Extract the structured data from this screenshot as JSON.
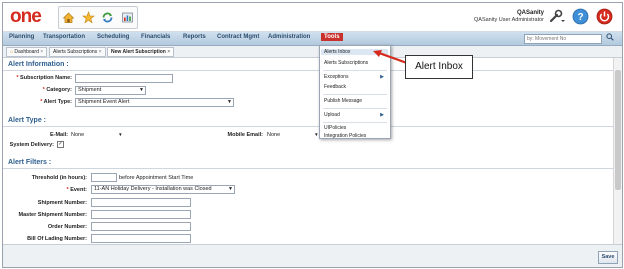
{
  "app": {
    "logo_text": "one"
  },
  "header": {
    "user_name": "QASanity",
    "user_role": "QASanity User Administrator",
    "quick_icons": [
      "home-icon",
      "star-icon",
      "refresh-icon",
      "report-icon"
    ],
    "right_icons": [
      "wrench-icon",
      "help-icon",
      "power-icon"
    ]
  },
  "nav": {
    "items": [
      "Planning",
      "Transportation",
      "Scheduling",
      "Financials",
      "Reports",
      "Contract Mgmt",
      "Administration",
      "Tools"
    ],
    "active": "Tools",
    "search_placeholder": "by: Movement No"
  },
  "tabs": [
    {
      "label": "Dashboard",
      "closable": true
    },
    {
      "label": "Alerts Subscriptions",
      "closable": true
    },
    {
      "label": "New Alert Subscription",
      "closable": true
    }
  ],
  "form": {
    "alert_info_title": "Alert Information :",
    "subscription_name_label": "Subscription Name:",
    "subscription_name_value": "",
    "category_label": "Category:",
    "category_value": "Shipment",
    "alert_type_label": "Alert Type:",
    "alert_type_value": "Shipment Event Alert",
    "alert_type_section_title": "Alert Type :",
    "email_label": "E-Mail:",
    "email_value": "None",
    "mobile_email_label": "Mobile Email:",
    "mobile_email_value": "None",
    "system_delivery_label": "System Delivery:",
    "system_delivery_checked": true,
    "alert_filters_title": "Alert Filters :",
    "threshold_label": "Threshold (in hours):",
    "threshold_value": "",
    "threshold_suffix": "before Appointment Start Time",
    "event_label": "Event:",
    "event_value": "11-AN Holiday Delivery - Installation was Closed",
    "shipment_number_label": "Shipment Number:",
    "master_shipment_number_label": "Master Shipment Number:",
    "order_number_label": "Order Number:",
    "bill_of_lading_label": "Bill Of Lading Number:"
  },
  "tools_menu": {
    "items": [
      {
        "label": "Alerts Inbox",
        "highlighted": true,
        "submenu": false
      },
      {
        "label": "Alerts Subscriptions",
        "highlighted": false,
        "submenu": false
      },
      {
        "label": "Exceptions",
        "highlighted": false,
        "submenu": true
      },
      {
        "label": "Feedback",
        "highlighted": false,
        "submenu": false
      },
      {
        "label": "Publish Message",
        "highlighted": false,
        "submenu": false
      },
      {
        "label": "Upload",
        "highlighted": false,
        "submenu": true
      },
      {
        "label": "UIPolicies",
        "highlighted": false,
        "submenu": false
      },
      {
        "label": "Integration Policies",
        "highlighted": false,
        "submenu": false
      }
    ]
  },
  "callout": {
    "text": "Alert Inbox"
  },
  "footer": {
    "save_label": "Save"
  },
  "colors": {
    "brand_red": "#d52b1e",
    "nav_blue": "#2d4d6f",
    "section_blue": "#2e5f8f",
    "active_tab_red": "#c9312d"
  }
}
